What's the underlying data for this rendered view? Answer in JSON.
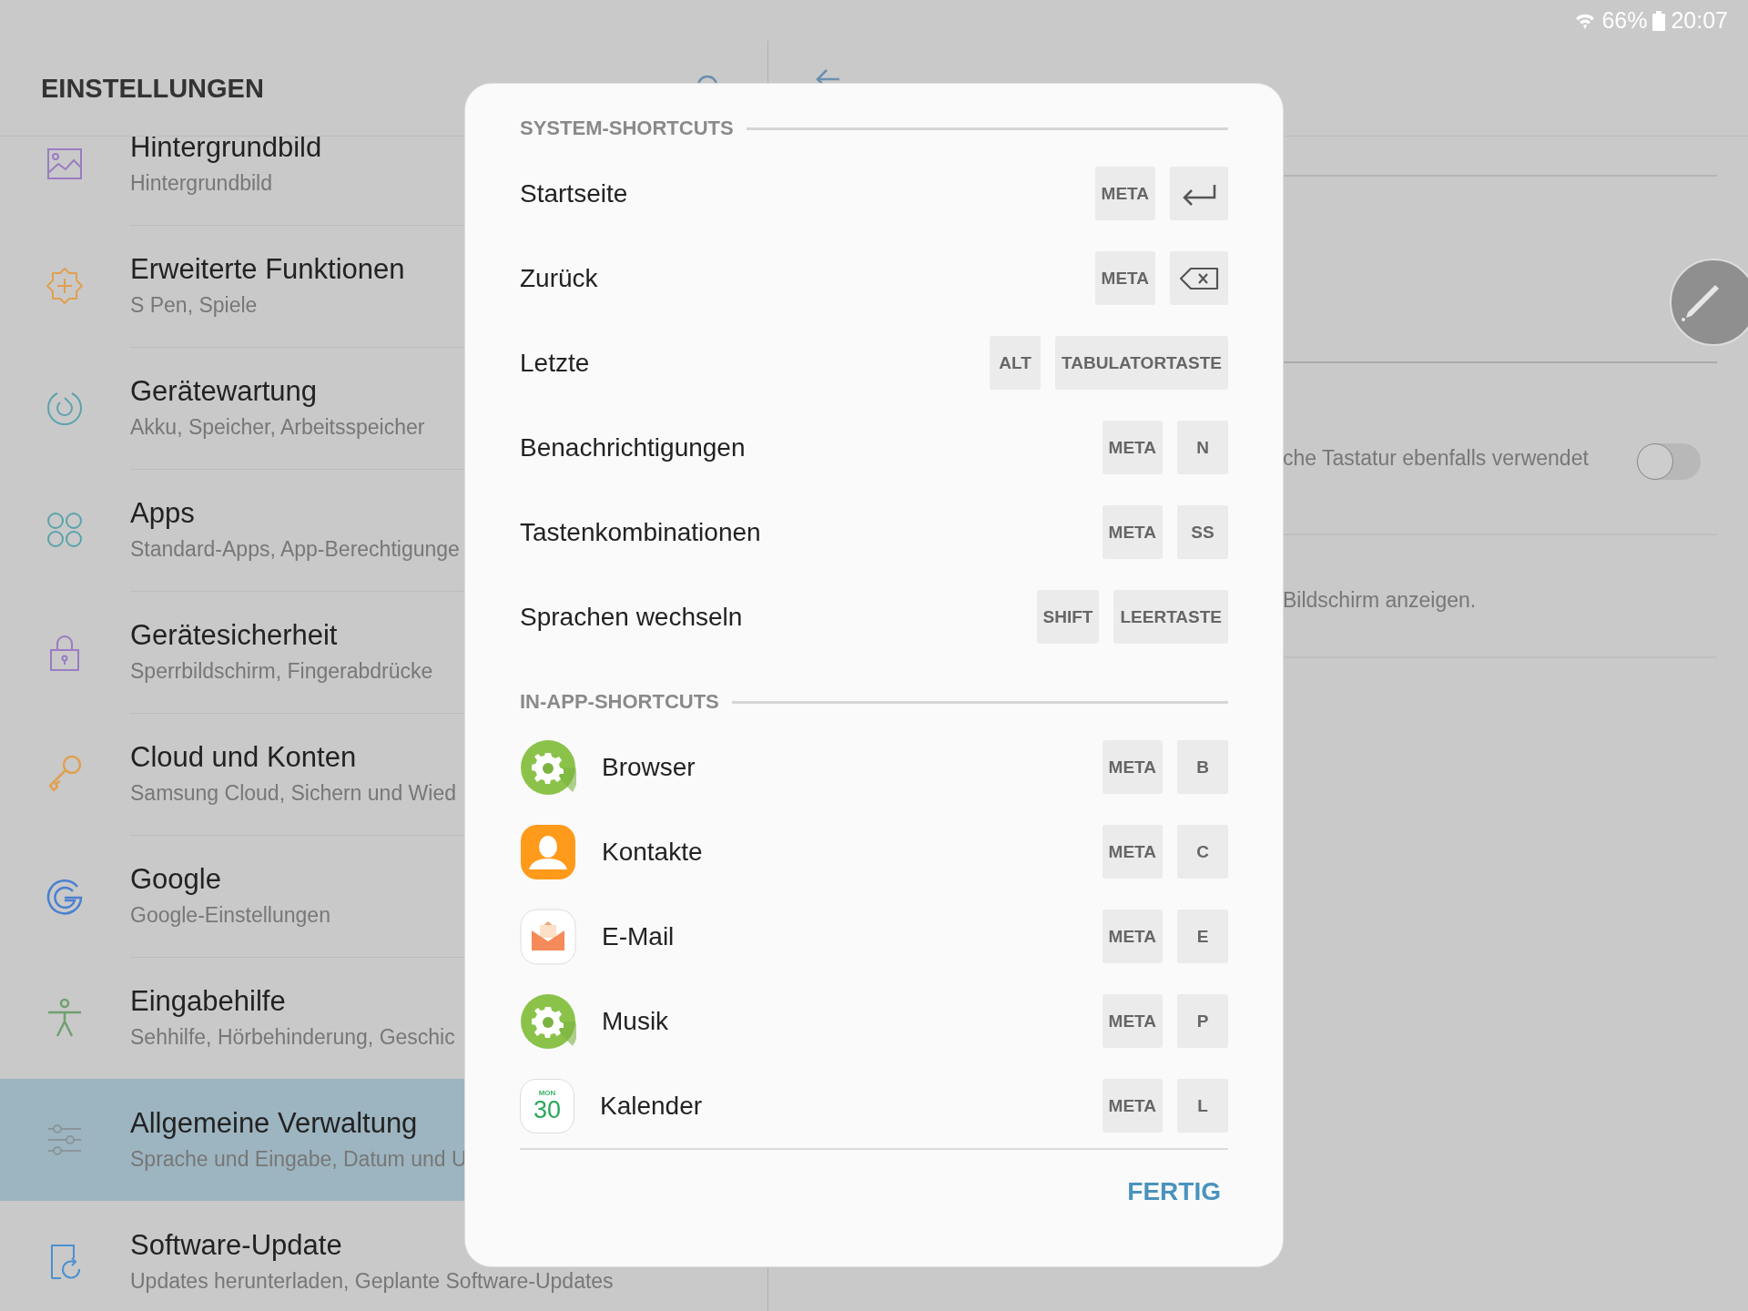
{
  "status_bar": {
    "battery": "66%",
    "time": "20:07"
  },
  "settings": {
    "title": "EINSTELLUNGEN",
    "items": [
      {
        "kind": "wallpaper",
        "title": "Hintergrundbild",
        "subtitle": "Hintergrundbild",
        "selected": false
      },
      {
        "kind": "advanced",
        "title": "Erweiterte Funktionen",
        "subtitle": "S Pen, Spiele",
        "selected": false
      },
      {
        "kind": "maintenance",
        "title": "Gerätewartung",
        "subtitle": "Akku, Speicher, Arbeitsspeicher",
        "selected": false
      },
      {
        "kind": "apps",
        "title": "Apps",
        "subtitle": "Standard-Apps, App-Berechtigunge",
        "selected": false
      },
      {
        "kind": "lock",
        "title": "Gerätesicherheit",
        "subtitle": "Sperrbildschirm, Fingerabdrücke",
        "selected": false
      },
      {
        "kind": "key",
        "title": "Cloud und Konten",
        "subtitle": "Samsung Cloud, Sichern und Wied",
        "selected": false
      },
      {
        "kind": "google",
        "title": "Google",
        "subtitle": "Google-Einstellungen",
        "selected": false
      },
      {
        "kind": "accessibility",
        "title": "Eingabehilfe",
        "subtitle": "Sehhilfe, Hörbehinderung, Geschic",
        "selected": false
      },
      {
        "kind": "sliders",
        "title": "Allgemeine Verwaltung",
        "subtitle": "Sprache und Eingabe, Datum und U",
        "selected": true
      },
      {
        "kind": "update",
        "title": "Software-Update",
        "subtitle": "Updates herunterladen, Geplante Software-Updates",
        "selected": false
      }
    ]
  },
  "detail": {
    "rows": [
      {
        "kind": "blank"
      },
      {
        "kind": "pen"
      },
      {
        "kind": "toggle",
        "text": "che Tastatur ebenfalls verwendet",
        "on": false
      },
      {
        "kind": "text",
        "text": "Bildschirm anzeigen."
      }
    ]
  },
  "dialog": {
    "sections": [
      {
        "title": "SYSTEM-SHORTCUTS",
        "shortcuts": [
          {
            "label": "Startseite",
            "keys": [
              {
                "kind": "text",
                "label": "META"
              },
              {
                "kind": "enter"
              }
            ]
          },
          {
            "label": "Zurück",
            "keys": [
              {
                "kind": "text",
                "label": "META"
              },
              {
                "kind": "backspace"
              }
            ]
          },
          {
            "label": "Letzte",
            "keys": [
              {
                "kind": "text",
                "label": "ALT"
              },
              {
                "kind": "text",
                "label": "TABULATORTASTE"
              }
            ]
          },
          {
            "label": "Benachrichtigungen",
            "keys": [
              {
                "kind": "text",
                "label": "META"
              },
              {
                "kind": "text",
                "label": "N"
              }
            ]
          },
          {
            "label": "Tastenkombinationen",
            "keys": [
              {
                "kind": "text",
                "label": "META"
              },
              {
                "kind": "text",
                "label": "SS"
              }
            ]
          },
          {
            "label": "Sprachen wechseln",
            "keys": [
              {
                "kind": "text",
                "label": "SHIFT"
              },
              {
                "kind": "text",
                "label": "LEERTASTE"
              }
            ]
          }
        ]
      },
      {
        "title": "IN-APP-SHORTCUTS",
        "shortcuts": [
          {
            "app": {
              "kind": "gear"
            },
            "label": "Browser",
            "keys": [
              {
                "kind": "text",
                "label": "META"
              },
              {
                "kind": "text",
                "label": "B"
              }
            ]
          },
          {
            "app": {
              "kind": "contacts"
            },
            "label": "Kontakte",
            "keys": [
              {
                "kind": "text",
                "label": "META"
              },
              {
                "kind": "text",
                "label": "C"
              }
            ]
          },
          {
            "app": {
              "kind": "email"
            },
            "label": "E-Mail",
            "keys": [
              {
                "kind": "text",
                "label": "META"
              },
              {
                "kind": "text",
                "label": "E"
              }
            ]
          },
          {
            "app": {
              "kind": "gear"
            },
            "label": "Musik",
            "keys": [
              {
                "kind": "text",
                "label": "META"
              },
              {
                "kind": "text",
                "label": "P"
              }
            ]
          },
          {
            "app": {
              "kind": "calendar",
              "day": "MON",
              "date": "30"
            },
            "label": "Kalender",
            "keys": [
              {
                "kind": "text",
                "label": "META"
              },
              {
                "kind": "text",
                "label": "L"
              }
            ]
          }
        ]
      }
    ],
    "done": "FERTIG"
  }
}
